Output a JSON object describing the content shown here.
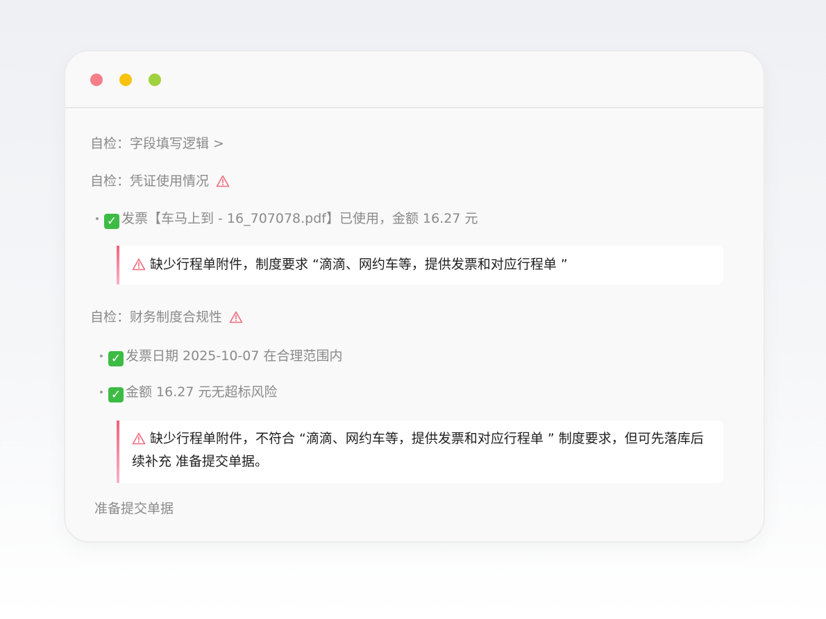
{
  "window": {
    "traffic_lights": {
      "close_color": "#f57f88",
      "minimize_color": "#f8c20f",
      "zoom_color": "#9fd23e"
    }
  },
  "checks": {
    "field_logic": "自检：字段填写逻辑 >",
    "voucher_usage": "自检：凭证使用情况",
    "voucher_item": "发票【车马上到 - 16_707078.pdf】已使用，金额 16.27 元",
    "voucher_warning": "缺少行程单附件，制度要求 “滴滴、网约车等，提供发票和对应行程单 ”",
    "policy_compliance": "自检：财务制度合规性",
    "policy_item_date": "发票日期 2025-10-07 在合理范围内",
    "policy_item_amount": "金额 16.27 元无超标风险",
    "policy_warning": "缺少行程单附件，不符合 “滴滴、网约车等，提供发票和对应行程单 ” 制度要求，但可先落库后续补充 准备提交单据。"
  },
  "footer": {
    "status": "准备提交单据"
  },
  "colors": {
    "accent_warning": "#f2607a",
    "check_green": "#3dbb45",
    "muted_text": "#8a8a8a"
  },
  "icons": {
    "warning": "warning-triangle-icon",
    "check": "check-mark-icon"
  }
}
